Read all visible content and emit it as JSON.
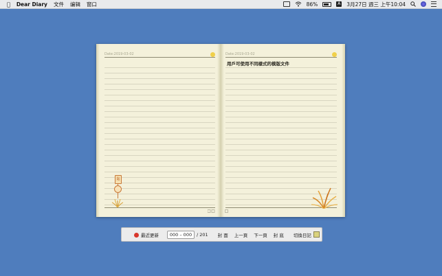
{
  "menubar": {
    "app_name": "Dear Diary",
    "menus": [
      "文件",
      "编辑",
      "窗口"
    ],
    "battery_percent": "86%",
    "input_method": "A",
    "datetime": "3月27日 週三 上午10:04"
  },
  "diary": {
    "left_page": {
      "date": "Date:2019-03-02",
      "tag_label": "貼"
    },
    "right_page": {
      "date": "Date:2019-03-02",
      "title": "用戶可使用不同樣式的模版文件"
    }
  },
  "toolbar": {
    "recent_label": "最近更新",
    "range_value": "000 – 000",
    "page_total": "/ 201",
    "front_cover_label": "封 面",
    "prev_label": "上一頁",
    "next_label": "下一頁",
    "back_cover_label": "封 底",
    "switch_label": "切換日記"
  },
  "colors": {
    "desktop": "#4f7dbd",
    "paper": "#f4f1db",
    "rule_line": "#d8d5c0",
    "accent_dot": "#f0d04a"
  }
}
